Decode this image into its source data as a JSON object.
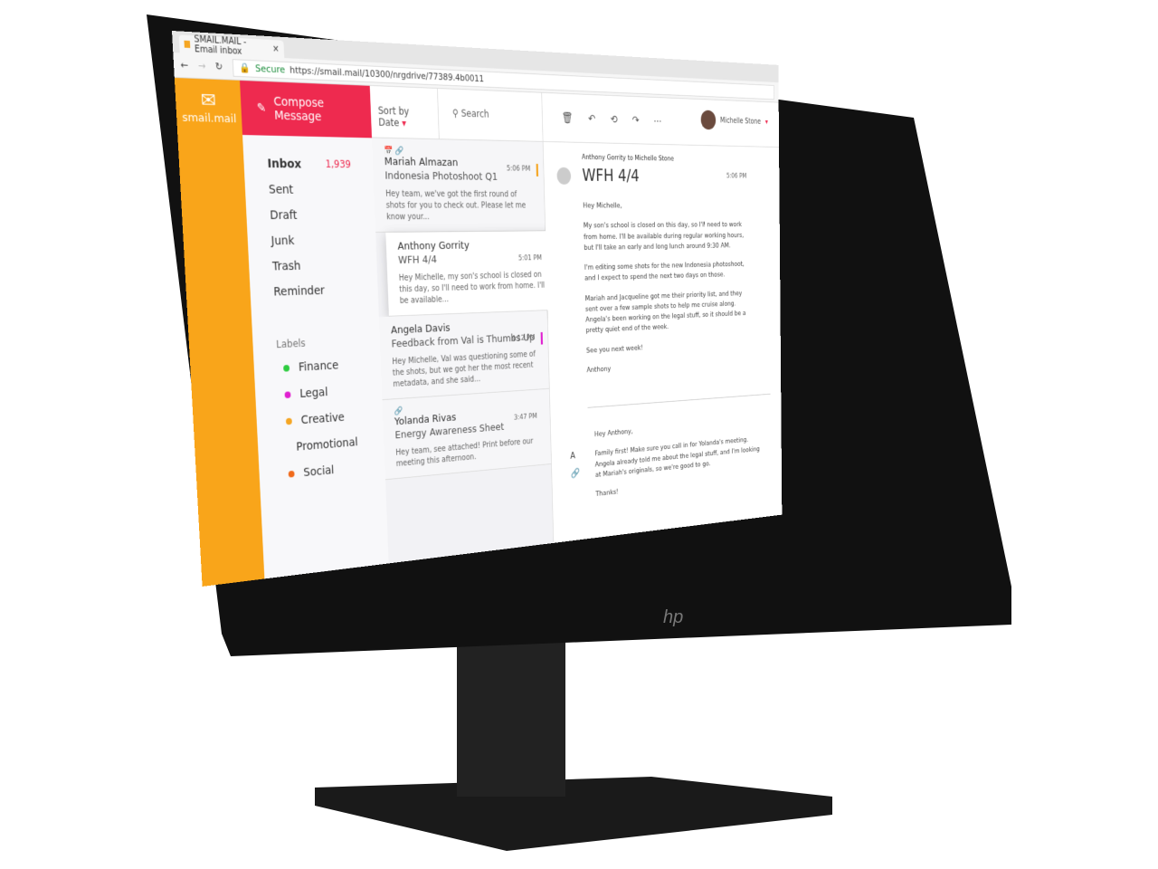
{
  "browser": {
    "tab_title": "SMAIL.MAIL - Email inbox",
    "secure": "Secure",
    "url": "https://smail.mail/10300/nrgdrive/77389.4b0011"
  },
  "brand": {
    "name": "smail.mail",
    "color": "#f9a51a"
  },
  "compose": {
    "label": "Compose Message",
    "color": "#ee2a4f"
  },
  "nav": {
    "items": [
      {
        "label": "Inbox",
        "count": "1,939"
      },
      {
        "label": "Sent"
      },
      {
        "label": "Draft"
      },
      {
        "label": "Junk"
      },
      {
        "label": "Trash"
      },
      {
        "label": "Reminder"
      }
    ],
    "labels_heading": "Labels",
    "labels": [
      {
        "label": "Finance",
        "color": "#2ecc40"
      },
      {
        "label": "Legal",
        "color": "#e020d0"
      },
      {
        "label": "Creative",
        "color": "#f5a623"
      },
      {
        "label": "Promotional",
        "color": "#1fa8e0"
      },
      {
        "label": "Social",
        "color": "#f06a1a"
      }
    ]
  },
  "list": {
    "sort": "Sort by Date",
    "search": "Search",
    "messages": [
      {
        "from": "Mariah Almazan",
        "subject": "Indonesia Photoshoot Q1",
        "time": "5:06 PM",
        "preview": "Hey team, we've got the first round of shots for you to check out. Please let me know your...",
        "color": "#f5a623"
      },
      {
        "from": "Anthony Gorrity",
        "subject": "WFH 4/4",
        "time": "5:01 PM",
        "preview": "Hey Michelle, my son's school is closed on this day, so I'll need to work from home. I'll be available...",
        "color": "#f5a623"
      },
      {
        "from": "Angela Davis",
        "subject": "Feedback from Val is Thumbs Up",
        "time": "4:12 PM",
        "preview": "Hey Michelle, Val was questioning some of the shots, but we got her the most recent metadata, and she said...",
        "color": "#e020d0"
      },
      {
        "from": "Yolanda Rivas",
        "subject": "Energy Awareness Sheet",
        "time": "3:47 PM",
        "preview": "Hey team, see attached! Print before our meeting this afternoon.",
        "color": ""
      }
    ]
  },
  "user": {
    "name": "Michelle Stone"
  },
  "reader": {
    "from_to": "Anthony Gorrity to Michelle Stone",
    "subject": "WFH 4/4",
    "time": "5:06 PM",
    "body": [
      "Hey Michelle,",
      "My son's school is closed on this day, so I'll need to work from home. I'll be available during regular working hours, but I'll take an early and long lunch around 9:30 AM.",
      "I'm editing some shots for the new Indonesia photoshoot, and I expect to spend the next two days on those.",
      "Mariah and Jacqueline got me their priority list, and they sent over a few sample shots to help me cruise along. Angela's been working on the legal stuff, so it should be a pretty quiet end of the week.",
      "See you next week!",
      "Anthony"
    ],
    "reply": [
      "Hey Anthony,",
      "Family first! Make sure you call in for Yolanda's meeting. Angela already told me about the legal stuff, and I'm looking at Mariah's originals, so we're good to go.",
      "Thanks!"
    ]
  },
  "monitor": {
    "logo": "hp"
  }
}
